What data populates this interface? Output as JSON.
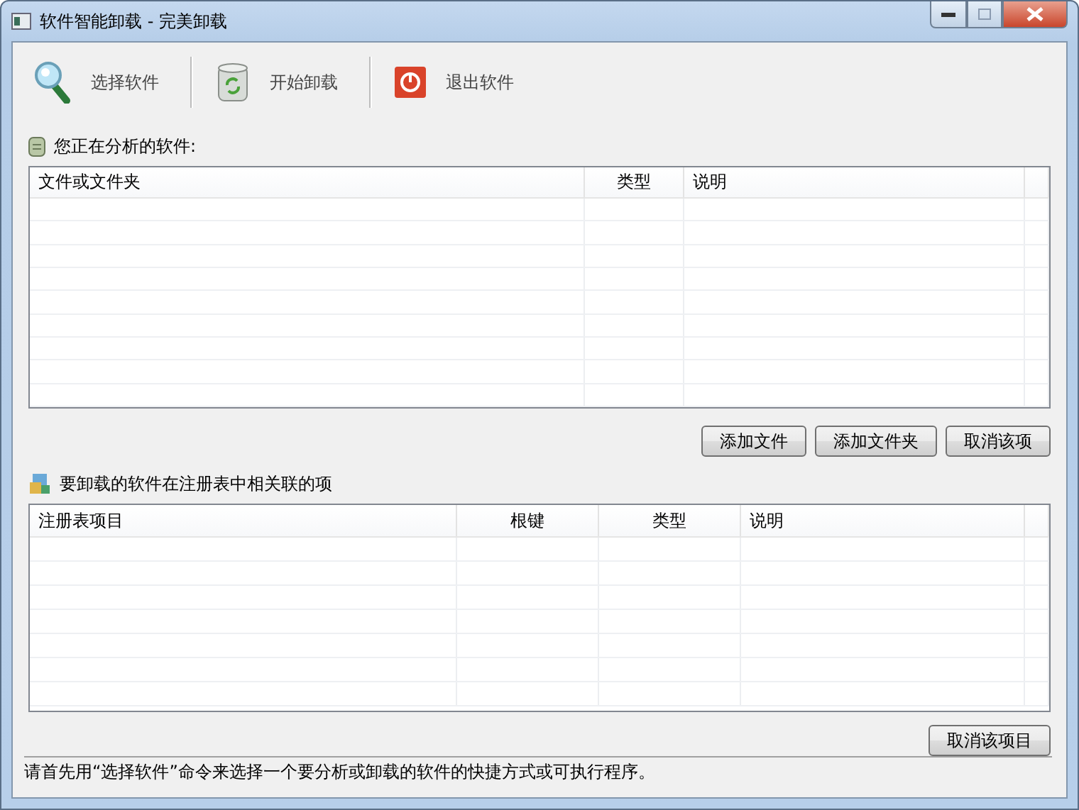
{
  "window": {
    "title": "软件智能卸载 - 完美卸载"
  },
  "toolbar": [
    {
      "kind": "search",
      "label": "选择软件"
    },
    {
      "kind": "bin",
      "label": "开始卸载"
    },
    {
      "kind": "power",
      "label": "退出软件"
    }
  ],
  "files_section": {
    "label": "您正在分析的软件:",
    "columns": [
      {
        "label": "文件或文件夹"
      },
      {
        "label": "类型"
      },
      {
        "label": "说明"
      }
    ],
    "buttons": [
      "添加文件",
      "添加文件夹",
      "取消该项"
    ]
  },
  "registry_section": {
    "label": "要卸载的软件在注册表中相关联的项",
    "columns": [
      {
        "label": "注册表项目"
      },
      {
        "label": "根键"
      },
      {
        "label": "类型"
      },
      {
        "label": "说明"
      }
    ],
    "buttons": [
      "取消该项目"
    ]
  },
  "status_bar": "请首先用“选择软件”命令来选择一个要分析或卸载的软件的快捷方式或可执行程序。"
}
